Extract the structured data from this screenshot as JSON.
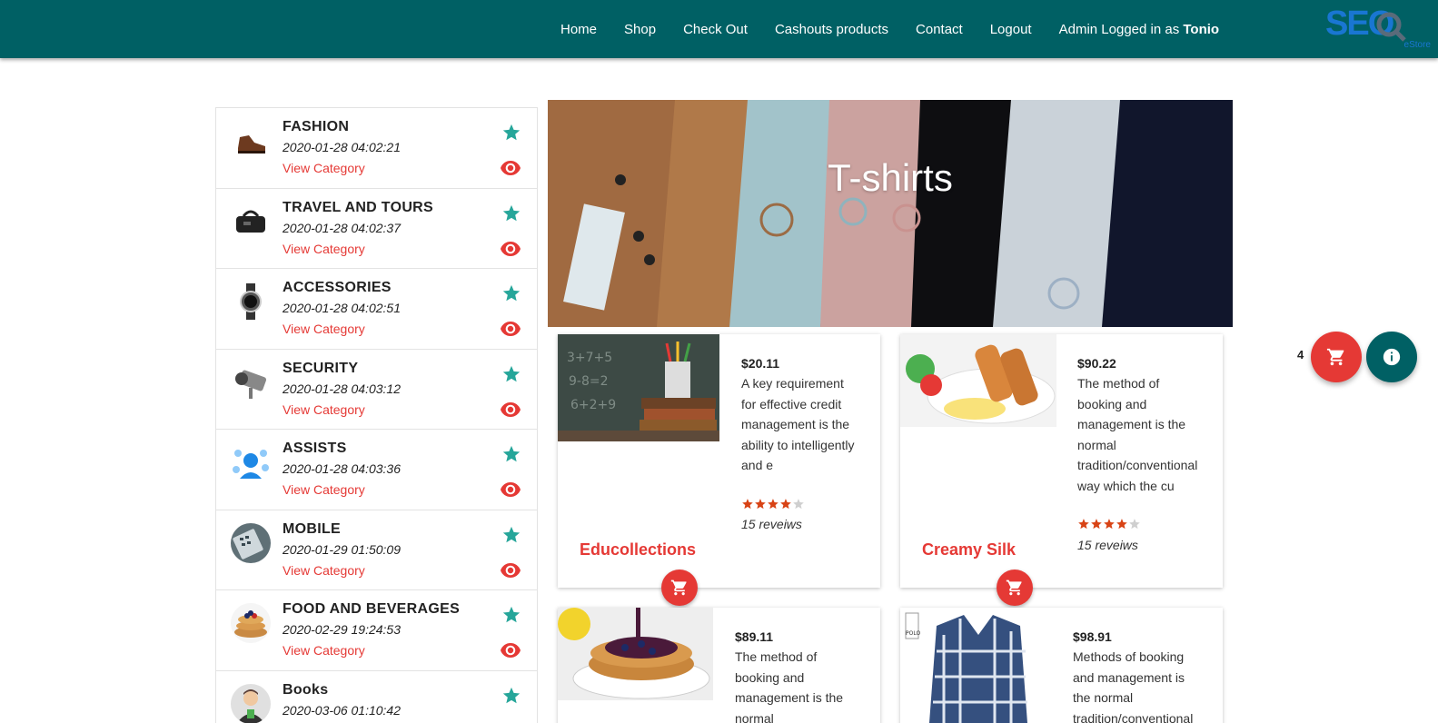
{
  "nav": {
    "home": "Home",
    "shop": "Shop",
    "checkout": "Check Out",
    "cashouts": "Cashouts products",
    "contact": "Contact",
    "logout": "Logout",
    "admin_prefix": "Admin Logged in as ",
    "admin_user": "Tonio"
  },
  "logo": {
    "main": "SEO",
    "sub": "eStore"
  },
  "categories": [
    {
      "name": "FASHION",
      "date": "2020-01-28 04:02:21",
      "link": "View Category",
      "icon": "shoe-icon"
    },
    {
      "name": "TRAVEL AND TOURS",
      "date": "2020-01-28 04:02:37",
      "link": "View Category",
      "icon": "bag-icon"
    },
    {
      "name": "ACCESSORIES",
      "date": "2020-01-28 04:02:51",
      "link": "View Category",
      "icon": "watch-icon"
    },
    {
      "name": "SECURITY",
      "date": "2020-01-28 04:03:12",
      "link": "View Category",
      "icon": "camera-icon"
    },
    {
      "name": "ASSISTS",
      "date": "2020-01-28 04:03:36",
      "link": "View Category",
      "icon": "support-icon"
    },
    {
      "name": "MOBILE",
      "date": "2020-01-29 01:50:09",
      "link": "View Category",
      "icon": "phone-icon"
    },
    {
      "name": "FOOD AND BEVERAGES",
      "date": "2020-02-29 19:24:53",
      "link": "View Category",
      "icon": "pancake-icon"
    },
    {
      "name": "Books",
      "date": "2020-03-06 01:10:42",
      "link": "View Category",
      "icon": "person-icon"
    }
  ],
  "banner": {
    "title": "T-shirts"
  },
  "products": [
    {
      "price": "$20.11",
      "desc": [
        "A key requirement",
        "for effective credit",
        "management is the",
        "ability to intelligently",
        "and e"
      ],
      "rating": 4,
      "reviews": "15 reveiws",
      "name": "Educollections"
    },
    {
      "price": "$90.22",
      "desc": [
        "The method of",
        "booking and",
        "management is the",
        "normal",
        "tradition/conventional",
        "way which the cu"
      ],
      "rating": 4,
      "reviews": "15 reveiws",
      "name": "Creamy Silk"
    },
    {
      "price": "$89.11",
      "desc": [
        "The method of",
        "booking and",
        "management is the",
        "normal"
      ]
    },
    {
      "price": "$98.91",
      "desc": [
        "Methods of booking",
        "and management is",
        "the normal",
        "tradition/conventional"
      ]
    }
  ],
  "cart": {
    "count": "4"
  },
  "colors": {
    "nav": "#006064",
    "accent": "#e53935",
    "star": "#26a69a"
  }
}
